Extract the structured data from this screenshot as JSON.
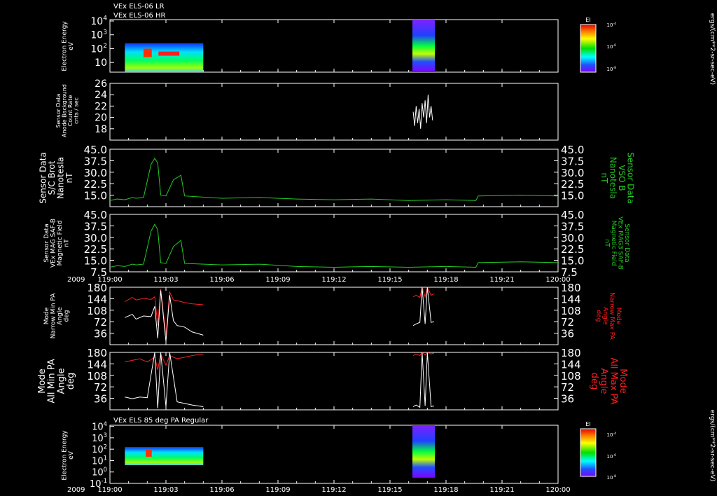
{
  "header": {
    "line1": "VEx ELS-06 LR",
    "line2": "VEx ELS-06 HR"
  },
  "time_axis": {
    "year_label": "2009",
    "ticks": [
      "119:00",
      "119:03",
      "119:06",
      "119:09",
      "119:12",
      "119:15",
      "119:18",
      "119:21",
      "120:00"
    ]
  },
  "colors": {
    "background": "#000000",
    "axes": "#ffffff",
    "mag_trace": "#22cc22",
    "max_pa_trace": "#ff2020",
    "min_pa_trace": "#ffffff",
    "right_label_green": "#22cc22",
    "right_label_red": "#ff2020"
  },
  "panels": {
    "els_lr": {
      "ylabel_lines": [
        "Electron Energy",
        "eV"
      ],
      "yticks": [
        {
          "base": "10",
          "exp": "4"
        },
        {
          "base": "10",
          "exp": "3"
        },
        {
          "base": "10",
          "exp": "2"
        },
        {
          "base": "10",
          "exp": ""
        }
      ],
      "colorbar": {
        "title": "EI",
        "ticks": [
          {
            "base": "10",
            "exp": "-4"
          },
          {
            "base": "10",
            "exp": "-6"
          },
          {
            "base": "10",
            "exp": "-8"
          }
        ],
        "unit": "ergs/(cm**2-sr-sec-eV)"
      }
    },
    "background": {
      "ylabel_lines": [
        "Sensor Data",
        "Anode Background",
        "Count Rate",
        "cnts / sec"
      ],
      "yticks": [
        "26",
        "24",
        "22",
        "20",
        "18"
      ]
    },
    "mag_sc": {
      "ylabel_lines": [
        "Sensor Data",
        "S/C Brot",
        "Nanotesla",
        "nT"
      ],
      "yticks": [
        "45.0",
        "37.5",
        "30.0",
        "22.5",
        "15.0"
      ],
      "right_label_lines": [
        "Sensor Data",
        "VSO B",
        "Nanotesla",
        "nT"
      ]
    },
    "mag_saf": {
      "ylabel_lines": [
        "Sensor Data",
        "VEx MAG SAF-B",
        "Magnetic Field",
        "nT"
      ],
      "yticks": [
        "45.0",
        "37.5",
        "30.0",
        "22.5",
        "15.0",
        "7.5"
      ],
      "right_label_lines": [
        "Sensor Data",
        "VEx MAG3 SAF-B",
        "Magnetic Field",
        "nT"
      ]
    },
    "narrow_pa": {
      "ylabel_lines": [
        "Mode",
        "Narrow Min PA",
        "Angle",
        "deg"
      ],
      "yticks": [
        "180",
        "144",
        "108",
        "72",
        "36"
      ],
      "right_label_lines": [
        "Mode",
        "Narrow Max PA",
        "Angle",
        "deg"
      ]
    },
    "all_pa": {
      "ylabel_lines": [
        "Mode",
        "All Min PA",
        "Angle",
        "deg"
      ],
      "yticks": [
        "180",
        "144",
        "108",
        "72",
        "36"
      ],
      "right_label_lines": [
        "Mode",
        "All Max PA",
        "Angle",
        "deg"
      ]
    },
    "els_85": {
      "title": "VEx ELS 85 deg PA Regular",
      "ylabel_lines": [
        "Electron Energy",
        "eV"
      ],
      "yticks": [
        {
          "base": "10",
          "exp": "4"
        },
        {
          "base": "10",
          "exp": "3"
        },
        {
          "base": "10",
          "exp": "2"
        },
        {
          "base": "10",
          "exp": "1"
        },
        {
          "base": "10",
          "exp": "0"
        },
        {
          "base": "10",
          "exp": "-1"
        }
      ],
      "colorbar": {
        "title": "EI",
        "ticks": [
          {
            "base": "10",
            "exp": "-4"
          },
          {
            "base": "10",
            "exp": "-6"
          },
          {
            "base": "10",
            "exp": "-8"
          }
        ],
        "unit": "ergs/(cm**2-sr-sec-eV)"
      }
    }
  },
  "chart_data": [
    {
      "type": "heatmap",
      "panel": "els_lr",
      "x_range": [
        "119:00",
        "120:00"
      ],
      "ylim_log10": [
        0.3,
        4.1
      ],
      "blocks": [
        {
          "t_start_min": 2.0,
          "t_end_min": 12.5,
          "log10E_range": [
            0.1,
            2.4
          ]
        },
        {
          "t_start_min": 40.5,
          "t_end_min": 43.5,
          "log10E_range": [
            -0.5,
            4.1
          ]
        }
      ]
    },
    {
      "type": "line",
      "panel": "background",
      "ylim": [
        16,
        26
      ],
      "series": [
        {
          "x": [
            40.6,
            40.8,
            41.0,
            41.2,
            41.4,
            41.6,
            41.8,
            42.0,
            42.2,
            42.4,
            42.6,
            42.8,
            43.0,
            43.2
          ],
          "y": [
            21,
            18.5,
            22,
            19,
            21.5,
            18,
            22.5,
            20,
            23,
            19,
            24,
            20,
            22,
            19.5
          ]
        }
      ]
    },
    {
      "type": "line",
      "panel": "mag_sc",
      "ylim": [
        7.5,
        45.0
      ],
      "series": [
        {
          "x": [
            0,
            1,
            2,
            3,
            3.5,
            4.5,
            5.5,
            6.0,
            6.4,
            6.8,
            7.5,
            8.5,
            9.0,
            9.5,
            10,
            15,
            20,
            25,
            30,
            35,
            40,
            45,
            49,
            49.3,
            55,
            60
          ],
          "y": [
            11.5,
            12.5,
            12.0,
            13.5,
            13.0,
            13.5,
            35.0,
            39.0,
            36.0,
            15.0,
            14.5,
            25.0,
            26.5,
            28.0,
            14.5,
            13.0,
            13.5,
            12.5,
            12.0,
            12.5,
            11.5,
            12.0,
            11.5,
            14.5,
            15.0,
            14.5
          ]
        }
      ]
    },
    {
      "type": "line",
      "panel": "mag_saf",
      "ylim": [
        7.5,
        45.0
      ],
      "series": [
        {
          "x": [
            0,
            1,
            2,
            3,
            3.5,
            4.5,
            5.5,
            6.0,
            6.4,
            6.8,
            7.5,
            8.5,
            9.0,
            9.5,
            10,
            15,
            20,
            25,
            30,
            35,
            40,
            45,
            49,
            49.3,
            55,
            60
          ],
          "y": [
            10.5,
            11.5,
            11.0,
            12.5,
            12.0,
            12.5,
            34.0,
            38.5,
            35.0,
            13.5,
            13.0,
            24.0,
            26.0,
            28.0,
            13.0,
            12.0,
            12.5,
            11.0,
            10.5,
            11.0,
            10.5,
            11.0,
            10.5,
            13.5,
            14.0,
            13.5
          ]
        }
      ]
    },
    {
      "type": "line",
      "panel": "narrow_pa",
      "ylim": [
        0,
        180
      ],
      "series": [
        {
          "x": [
            2.0,
            3.0,
            3.5,
            4.5,
            5.5,
            6.0,
            6.4,
            6.8,
            7.5,
            8.0,
            8.5,
            9.0,
            10,
            11,
            12.5
          ],
          "y": [
            135,
            148,
            140,
            145,
            142,
            150,
            60,
            175,
            30,
            165,
            140,
            138,
            132,
            128,
            125
          ]
        },
        {
          "x": [
            2.0,
            3.0,
            3.5,
            4.5,
            5.5,
            6.0,
            6.4,
            6.8,
            7.5,
            8.0,
            8.5,
            9.0,
            10,
            11,
            12.5
          ],
          "y": [
            85,
            95,
            80,
            90,
            88,
            120,
            20,
            170,
            10,
            155,
            75,
            60,
            55,
            40,
            30
          ]
        },
        {
          "x": [
            40.6,
            41.0,
            41.5,
            41.8,
            42.2,
            42.5,
            43.0,
            43.4
          ],
          "y": [
            150,
            155,
            148,
            180,
            150,
            180,
            155,
            160
          ]
        },
        {
          "x": [
            40.6,
            41.0,
            41.5,
            41.8,
            42.2,
            42.5,
            43.0,
            43.4
          ],
          "y": [
            60,
            65,
            70,
            180,
            65,
            180,
            70,
            72
          ]
        }
      ]
    },
    {
      "type": "line",
      "panel": "all_pa",
      "ylim": [
        0,
        180
      ],
      "series": [
        {
          "x": [
            2.0,
            3.0,
            4.0,
            5.0,
            6.0,
            6.4,
            6.8,
            7.5,
            8.0,
            9.0,
            10,
            11,
            12.5
          ],
          "y": [
            150,
            155,
            160,
            150,
            165,
            125,
            175,
            140,
            170,
            160,
            165,
            170,
            175
          ]
        },
        {
          "x": [
            2.0,
            3.0,
            4.0,
            5.0,
            6.0,
            6.4,
            6.8,
            7.5,
            8.0,
            9.0,
            10,
            11,
            12.5
          ],
          "y": [
            40,
            35,
            40,
            38,
            180,
            5,
            180,
            10,
            180,
            25,
            20,
            15,
            10
          ]
        },
        {
          "x": [
            40.6,
            41.0,
            41.5,
            41.8,
            42.2,
            42.5,
            43.0,
            43.4
          ],
          "y": [
            170,
            175,
            170,
            180,
            172,
            180,
            175,
            178
          ]
        },
        {
          "x": [
            40.6,
            41.0,
            41.5,
            41.8,
            42.2,
            42.5,
            43.0,
            43.4
          ],
          "y": [
            10,
            15,
            8,
            180,
            12,
            180,
            10,
            12
          ]
        }
      ]
    },
    {
      "type": "heatmap",
      "panel": "els_85",
      "x_range": [
        "119:00",
        "120:00"
      ],
      "ylim_log10": [
        -1,
        4.1
      ],
      "blocks": [
        {
          "t_start_min": 2.0,
          "t_end_min": 12.5,
          "log10E_range": [
            0.6,
            2.2
          ]
        },
        {
          "t_start_min": 40.5,
          "t_end_min": 43.5,
          "log10E_range": [
            -0.5,
            4.1
          ]
        }
      ]
    }
  ]
}
